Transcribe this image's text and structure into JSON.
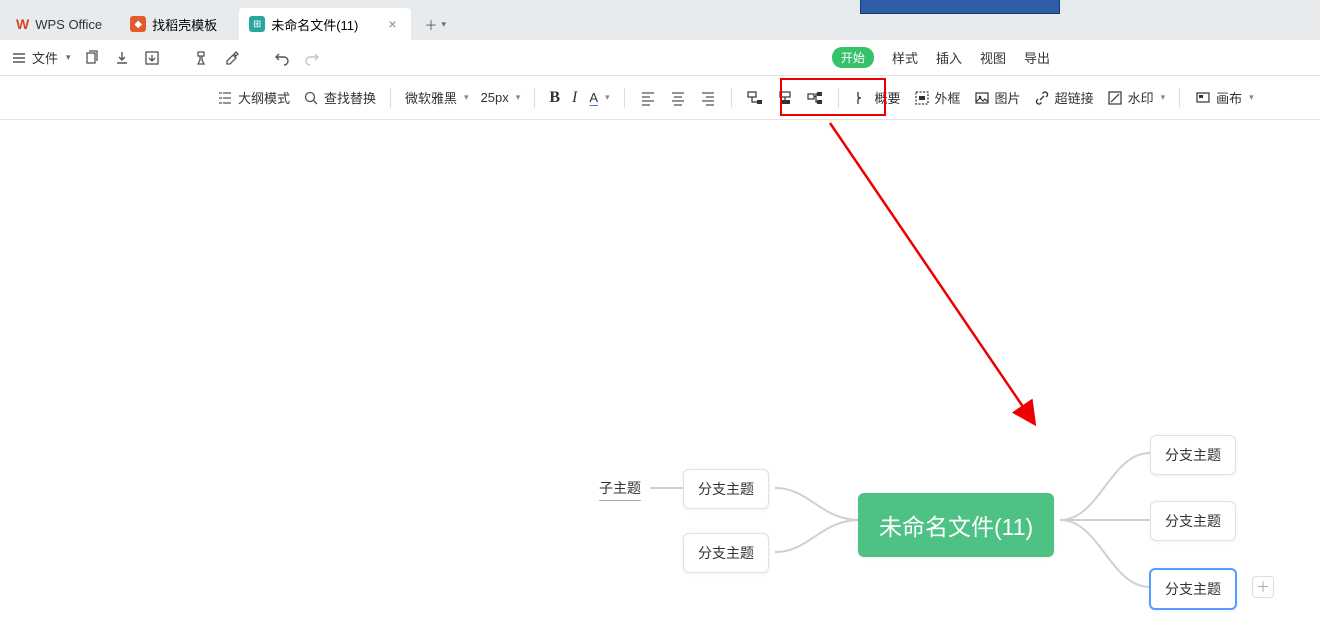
{
  "titlebar": {
    "brand": "WPS Office",
    "tabs": [
      {
        "icon_bg": "#e05a2b",
        "label": "找稻壳模板",
        "active": false
      },
      {
        "icon_bg": "#2aa5a0",
        "label": "未命名文件(11)",
        "active": true
      }
    ]
  },
  "quickbar": {
    "file_label": "文件"
  },
  "menus": {
    "active": "开始",
    "items": [
      "样式",
      "插入",
      "视图",
      "导出"
    ]
  },
  "ribbon": {
    "outline": "大纲模式",
    "find": "查找替换",
    "font": "微软雅黑",
    "size": "25px",
    "summary": "概要",
    "frame": "外框",
    "image": "图片",
    "link": "超链接",
    "watermark": "水印",
    "canvas_label": "画布"
  },
  "mindmap": {
    "central": "未命名文件(11)",
    "left_nodes": [
      "分支主题",
      "分支主题"
    ],
    "left_child": "子主题",
    "right_nodes": [
      "分支主题",
      "分支主题",
      "分支主题"
    ]
  }
}
